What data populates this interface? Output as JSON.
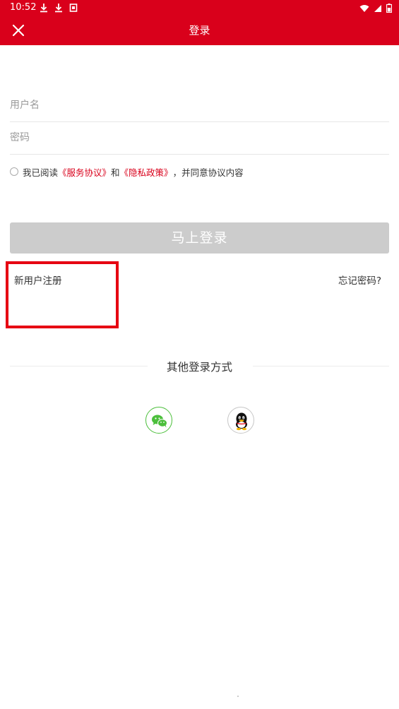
{
  "status_bar": {
    "time": "10:52",
    "icons": [
      "download-icon",
      "download-icon",
      "screenshot-icon"
    ],
    "right_icons": [
      "wifi-icon",
      "signal-icon",
      "battery-icon"
    ]
  },
  "header": {
    "title": "登录",
    "close_icon": "close-icon",
    "background": "#d9001b"
  },
  "form": {
    "username_placeholder": "用户名",
    "password_placeholder": "密码",
    "agreement": {
      "prefix": "我已阅读",
      "service_link": "《服务协议》",
      "and": "和",
      "privacy_link": "《隐私政策》",
      "suffix": "，并同意协议内容",
      "checked": false
    },
    "login_button": "马上登录",
    "register_link": "新用户注册",
    "forgot_link": "忘记密码?"
  },
  "other_login": {
    "label": "其他登录方式",
    "methods": [
      {
        "name": "wechat",
        "icon": "wechat-icon",
        "color": "#4cbf3c"
      },
      {
        "name": "qq",
        "icon": "qq-icon"
      }
    ]
  },
  "colors": {
    "accent": "#d9001b",
    "button_disabled": "#cccccc",
    "highlight_box": "#e60012"
  }
}
